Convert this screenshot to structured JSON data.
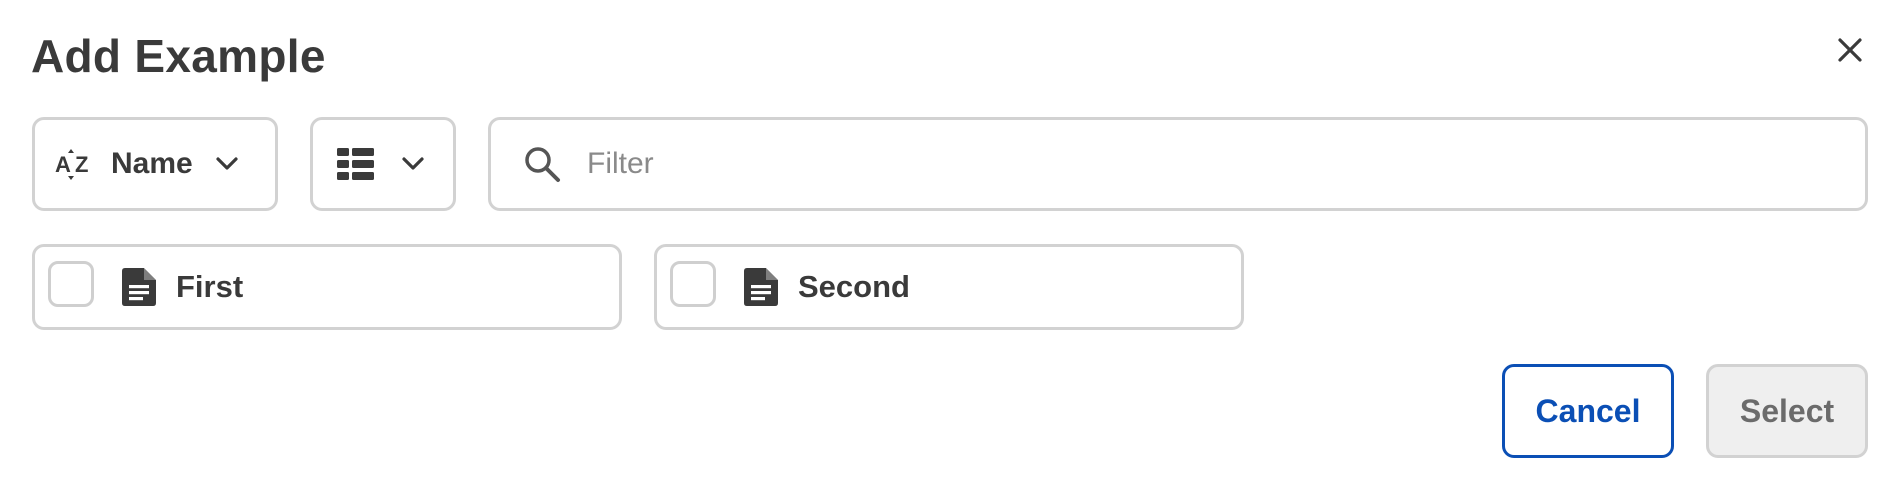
{
  "dialog": {
    "title": "Add Example"
  },
  "toolbar": {
    "sort": {
      "label": "Name",
      "icon": "sort-alpha-icon"
    },
    "view": {
      "icon": "grid-view-icon"
    },
    "filter": {
      "placeholder": "Filter",
      "value": ""
    }
  },
  "items": [
    {
      "label": "First",
      "checked": false,
      "icon": "document-icon"
    },
    {
      "label": "Second",
      "checked": false,
      "icon": "document-icon"
    }
  ],
  "actions": {
    "cancel_label": "Cancel",
    "select_label": "Select"
  },
  "colors": {
    "primary": "#0b4fb5",
    "border": "#d2d2d2",
    "text": "#3a3a3a",
    "disabled_bg": "#efefef"
  }
}
